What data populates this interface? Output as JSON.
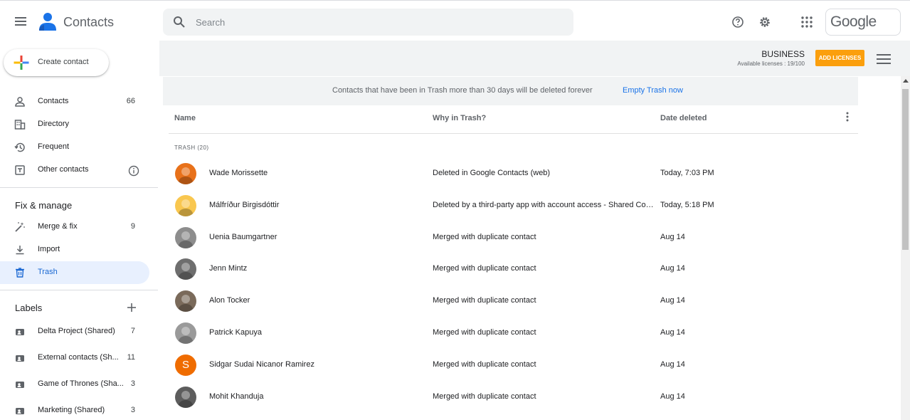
{
  "header": {
    "app_title": "Contacts",
    "search_placeholder": "Search",
    "google_label": "Google"
  },
  "business": {
    "title": "BUSINESS",
    "subtitle": "Available licenses : 19/100",
    "add_licenses_label": "ADD LICENSES"
  },
  "create_contact_label": "Create contact",
  "sidebar": {
    "nav": [
      {
        "label": "Contacts",
        "count": "66",
        "icon": "person-icon"
      },
      {
        "label": "Directory",
        "count": "",
        "icon": "building-icon"
      },
      {
        "label": "Frequent",
        "count": "",
        "icon": "history-icon"
      },
      {
        "label": "Other contacts",
        "count": "",
        "icon": "add-to-box-icon"
      }
    ],
    "fix_manage_title": "Fix & manage",
    "fix_manage": [
      {
        "label": "Merge & fix",
        "count": "9",
        "icon": "magic-wand-icon"
      },
      {
        "label": "Import",
        "count": "",
        "icon": "download-icon"
      },
      {
        "label": "Trash",
        "count": "",
        "icon": "trash-icon"
      }
    ],
    "labels_title": "Labels",
    "labels": [
      {
        "label": "Delta Project (Shared)",
        "count": "7"
      },
      {
        "label": "External contacts (Sh...",
        "count": "11"
      },
      {
        "label": "Game of Thrones (Sha...",
        "count": "3"
      },
      {
        "label": "Marketing (Shared)",
        "count": "3"
      }
    ]
  },
  "notice": {
    "text": "Contacts that have been in Trash more than 30 days will be deleted forever",
    "link": "Empty Trash now"
  },
  "table": {
    "columns": [
      "Name",
      "Why in Trash?",
      "Date deleted"
    ],
    "section_label": "TRASH (20)",
    "rows": [
      {
        "name": "Wade Morissette",
        "why": "Deleted in Google Contacts (web)",
        "date": "Today, 7:03 PM",
        "avatar_color": "#e8711a",
        "initial": ""
      },
      {
        "name": "Málfríður Birgisdóttir",
        "why": "Deleted by a third-party app with account access - Shared Contacts",
        "date": "Today, 5:18 PM",
        "avatar_color": "#f9c74f",
        "initial": ""
      },
      {
        "name": "Uenia Baumgartner",
        "why": "Merged with duplicate contact",
        "date": "Aug 14",
        "avatar_color": "#8d8d8d",
        "initial": ""
      },
      {
        "name": "Jenn Mintz",
        "why": "Merged with duplicate contact",
        "date": "Aug 14",
        "avatar_color": "#6e6e6e",
        "initial": ""
      },
      {
        "name": "Alon Tocker",
        "why": "Merged with duplicate contact",
        "date": "Aug 14",
        "avatar_color": "#7a6a5a",
        "initial": ""
      },
      {
        "name": "Patrick Kapuya",
        "why": "Merged with duplicate contact",
        "date": "Aug 14",
        "avatar_color": "#9a9a9a",
        "initial": ""
      },
      {
        "name": "Sidgar Sudai Nicanor Ramirez",
        "why": "Merged with duplicate contact",
        "date": "Aug 14",
        "avatar_color": "#ef6c00",
        "initial": "S"
      },
      {
        "name": "Mohit Khanduja",
        "why": "Merged with duplicate contact",
        "date": "Aug 14",
        "avatar_color": "#5d5d5d",
        "initial": ""
      }
    ]
  },
  "colors": {
    "accent": "#1a73e8",
    "active_bg": "#e8f0fe",
    "add_licenses_bg": "#fb9f0d"
  }
}
